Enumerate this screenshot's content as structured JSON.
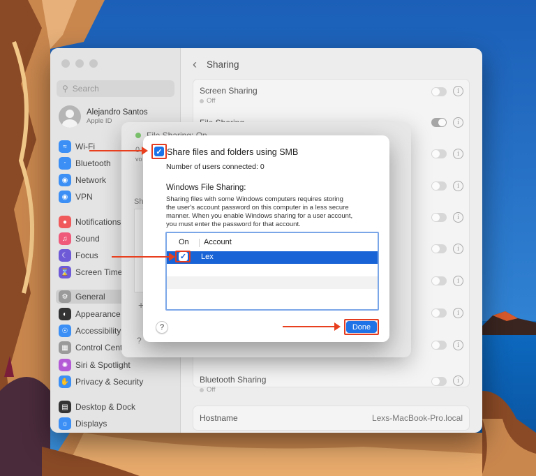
{
  "window": {
    "search_placeholder": "Search",
    "user": {
      "name": "Alejandro Santos",
      "sub": "Apple ID"
    },
    "sidebar_items": [
      {
        "label": "Wi-Fi",
        "icon": "wifi-icon",
        "color": "#3b8ff5"
      },
      {
        "label": "Bluetooth",
        "icon": "bluetooth-icon",
        "color": "#3b8ff5"
      },
      {
        "label": "Network",
        "icon": "network-icon",
        "color": "#3b8ff5"
      },
      {
        "label": "VPN",
        "icon": "vpn-icon",
        "color": "#3b8ff5"
      },
      {
        "label": "Notifications",
        "icon": "bell-icon",
        "color": "#f05a5a"
      },
      {
        "label": "Sound",
        "icon": "speaker-icon",
        "color": "#f05a7a"
      },
      {
        "label": "Focus",
        "icon": "moon-icon",
        "color": "#6e5ad6"
      },
      {
        "label": "Screen Time",
        "icon": "hourglass-icon",
        "color": "#6e5ad6"
      },
      {
        "label": "General",
        "icon": "gear-icon",
        "color": "#9a9a9a"
      },
      {
        "label": "Appearance",
        "icon": "appearance-icon",
        "color": "#333333"
      },
      {
        "label": "Accessibility",
        "icon": "accessibility-icon",
        "color": "#3b8ff5"
      },
      {
        "label": "Control Cent",
        "icon": "control-center-icon",
        "color": "#9a9a9a"
      },
      {
        "label": "Siri & Spotlight",
        "icon": "siri-icon",
        "color": "#b45ad6"
      },
      {
        "label": "Privacy & Security",
        "icon": "hand-icon",
        "color": "#3b8ff5"
      },
      {
        "label": "Desktop & Dock",
        "icon": "dock-icon",
        "color": "#333333"
      },
      {
        "label": "Displays",
        "icon": "displays-icon",
        "color": "#3b8ff5"
      }
    ],
    "main_title": "Sharing",
    "rows": [
      {
        "label": "Screen Sharing",
        "status": "Off"
      },
      {
        "label": "File Sharing"
      },
      {
        "label": "Bluetooth Sharing",
        "status": "Off"
      }
    ],
    "hostname_label": "Hostname",
    "hostname_value": "Lexs-MacBook-Pro.local"
  },
  "sheet": {
    "title": "File Sharing: On",
    "frag_left_1": "0",
    "frag_left_2": "vo",
    "frag_shared": "Sh",
    "frag_plus": "+",
    "frag_question": "?"
  },
  "dialog": {
    "smb_label": "Share files and folders using SMB",
    "users_connected": "Number of users connected: 0",
    "windows_heading": "Windows File Sharing:",
    "windows_desc": [
      "Sharing files with some Windows computers requires storing",
      "the user's account password on this computer in a less secure",
      "manner. When you enable Windows sharing for a user account,",
      "you must enter the password for that account."
    ],
    "col_on": "On",
    "col_account": "Account",
    "account_name": "Lex",
    "help": "?",
    "done": "Done",
    "check_glyph": "✓"
  },
  "colors": {
    "accent": "#1f73e6",
    "annotation": "#e8401f",
    "selection": "#1863d6"
  }
}
